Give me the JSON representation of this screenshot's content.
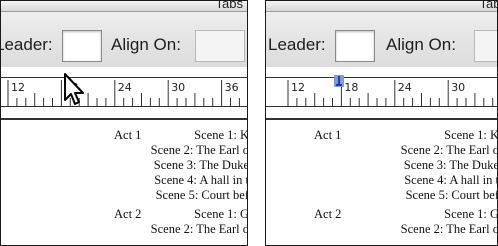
{
  "window": {
    "title": "Tabs"
  },
  "tab_controls": {
    "leader_label": "Leader:",
    "align_on_label": "Align On:"
  },
  "ruler": {
    "ticks": [
      "12",
      "18",
      "24"
    ]
  },
  "document": {
    "lines": [
      {
        "col1": "Act 1",
        "col2": "Scene 1: K"
      },
      {
        "col1": "",
        "col2": "Scene 2: The Earl o"
      },
      {
        "col1": "",
        "col2": "Scene 3: The Duke"
      },
      {
        "col1": "",
        "col2": "Scene 4: A hall in t"
      },
      {
        "col1": "",
        "col2": "Scene 5: Court bef"
      },
      {
        "col1": "Act 2",
        "col2": "Scene 1: G"
      },
      {
        "col1": "",
        "col2": "Scene 2: The Earl o"
      }
    ]
  },
  "colors": {
    "ruler_marker": "#4a70c9",
    "frame": "#1a1a1a"
  },
  "icons": {
    "pointer": "arrow-cursor-icon",
    "tab_stop": "tab-stop-marker-icon"
  }
}
